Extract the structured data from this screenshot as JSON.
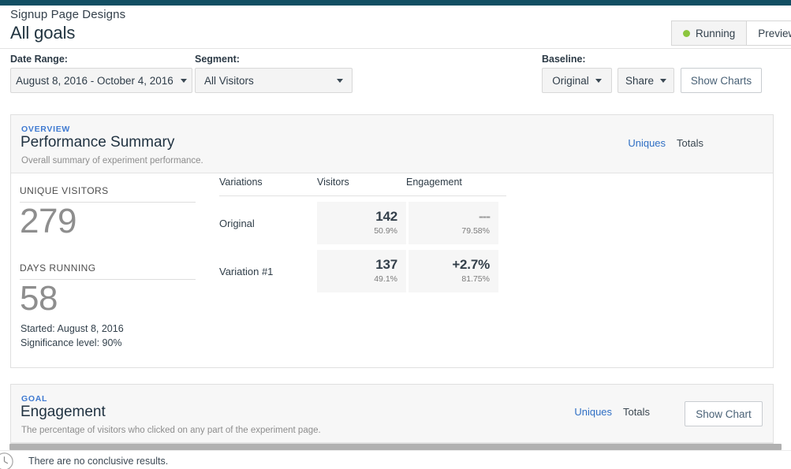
{
  "header": {
    "experiment_name": "Signup Page Designs",
    "page_title": "All goals",
    "status_label": "Running",
    "status_color": "#8cc63e",
    "preview_label": "Preview"
  },
  "filters": {
    "date_range_label": "Date Range:",
    "date_range_value": "August 8, 2016 - October 4, 2016",
    "segment_label": "Segment:",
    "segment_value": "All Visitors",
    "baseline_label": "Baseline:",
    "baseline_value": "Original",
    "share_label": "Share",
    "show_charts_label": "Show Charts"
  },
  "summary_panel": {
    "eyebrow": "OVERVIEW",
    "title": "Performance Summary",
    "description": "Overall summary of experiment performance.",
    "toggle_uniques": "Uniques",
    "toggle_totals": "Totals",
    "stats": {
      "unique_visitors_label": "UNIQUE VISITORS",
      "unique_visitors_value": "279",
      "days_running_label": "DAYS RUNNING",
      "days_running_value": "58",
      "started": "Started: August 8, 2016",
      "significance": "Significance level: 90%"
    },
    "table": {
      "columns": [
        "Variations",
        "Visitors",
        "Engagement"
      ],
      "rows": [
        {
          "name": "Original",
          "visitors_value": "142",
          "visitors_pct": "50.9%",
          "engagement_value": "---",
          "engagement_pct": "79.58%"
        },
        {
          "name": "Variation #1",
          "visitors_value": "137",
          "visitors_pct": "49.1%",
          "engagement_value": "+2.7%",
          "engagement_pct": "81.75%"
        }
      ]
    }
  },
  "goal_panel": {
    "eyebrow": "GOAL",
    "title": "Engagement",
    "description": "The percentage of visitors who clicked on any part of the experiment page.",
    "toggle_uniques": "Uniques",
    "toggle_totals": "Totals",
    "show_chart_label": "Show Chart"
  },
  "footer": {
    "status_message": "There are no conclusive results."
  }
}
